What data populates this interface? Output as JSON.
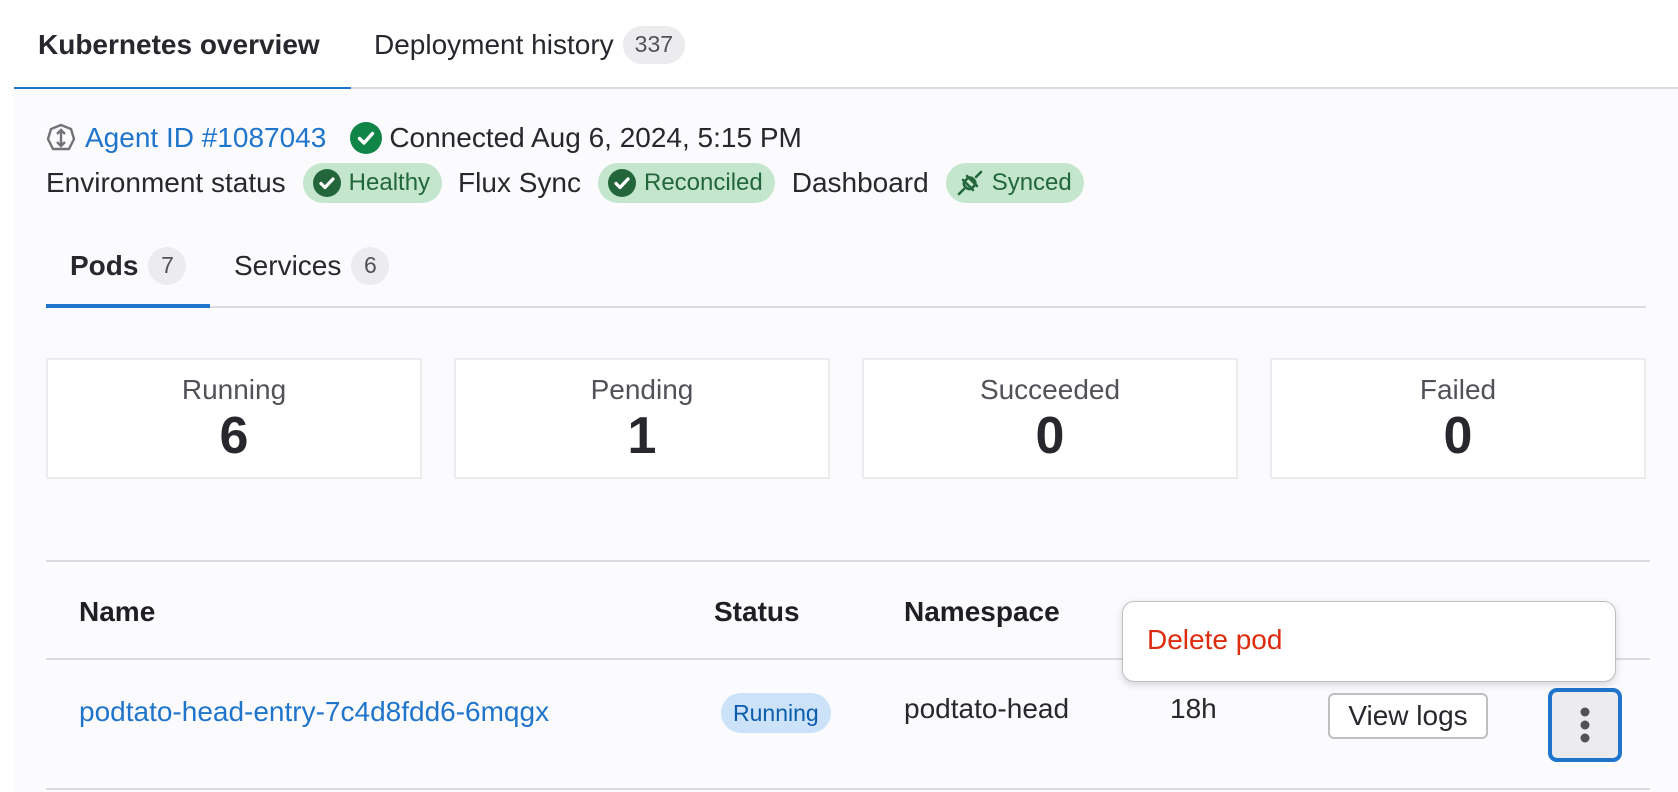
{
  "top_tabs": [
    {
      "label": "Kubernetes overview",
      "active": true
    },
    {
      "label": "Deployment history",
      "count": "337",
      "active": false
    }
  ],
  "agent": {
    "icon": "agent-icon",
    "link_label": "Agent ID #1087043",
    "connection_icon": "check-circle-icon",
    "connection_text": "Connected Aug 6, 2024, 5:15 PM"
  },
  "status": {
    "environment_label": "Environment status",
    "environment_badge": "Healthy",
    "flux_label": "Flux Sync",
    "flux_badge": "Reconciled",
    "dashboard_label": "Dashboard",
    "dashboard_badge": "Synced",
    "badge_color": "#c3e6cd",
    "badge_text_color": "#24663b"
  },
  "sub_tabs": [
    {
      "label": "Pods",
      "count": "7",
      "active": true
    },
    {
      "label": "Services",
      "count": "6",
      "active": false
    }
  ],
  "summary_cards": [
    {
      "label": "Running",
      "value": "6"
    },
    {
      "label": "Pending",
      "value": "1"
    },
    {
      "label": "Succeeded",
      "value": "0"
    },
    {
      "label": "Failed",
      "value": "0"
    }
  ],
  "table": {
    "headers": [
      "Name",
      "Status",
      "Namespace"
    ],
    "rows": [
      {
        "name": "podtato-head-entry-7c4d8fdd6-6mqgx",
        "status": "Running",
        "namespace": "podtato-head",
        "age": "18h",
        "action_label": "View logs",
        "more_icon": "kebab-vertical-icon"
      }
    ]
  },
  "dropdown": {
    "items": [
      {
        "label": "Delete pod",
        "color": "#dd2b0e"
      }
    ]
  },
  "colors": {
    "accent": "#1f75cb",
    "danger": "#dd2b0e"
  }
}
